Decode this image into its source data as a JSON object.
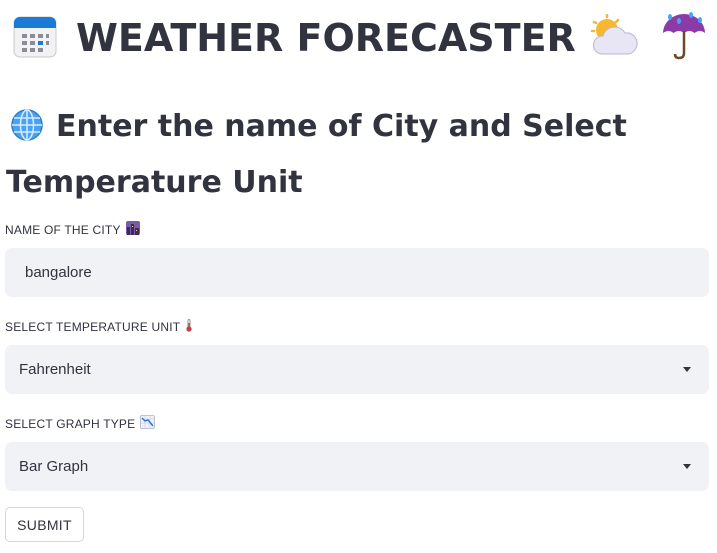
{
  "header": {
    "title": "WEATHER FORECASTER",
    "icons": [
      "calendar-icon",
      "sun-behind-cloud-icon",
      "umbrella-with-rain-icon"
    ]
  },
  "subheader": {
    "text": "Enter the name of City and Select Temperature Unit",
    "icon": "globe-icon"
  },
  "form": {
    "city": {
      "label": "NAME OF THE CITY",
      "icon": "cityscape-dusk-icon",
      "value": "bangalore"
    },
    "unit": {
      "label": "SELECT TEMPERATURE UNIT",
      "icon": "thermometer-icon",
      "selected": "Fahrenheit"
    },
    "graph": {
      "label": "SELECT GRAPH TYPE",
      "icon": "chart-decreasing-icon",
      "selected": "Bar Graph"
    },
    "submit_label": "SUBMIT"
  },
  "colors": {
    "text": "#31333f",
    "input_bg": "#f0f2f6",
    "button_border": "#d6d6d9"
  }
}
